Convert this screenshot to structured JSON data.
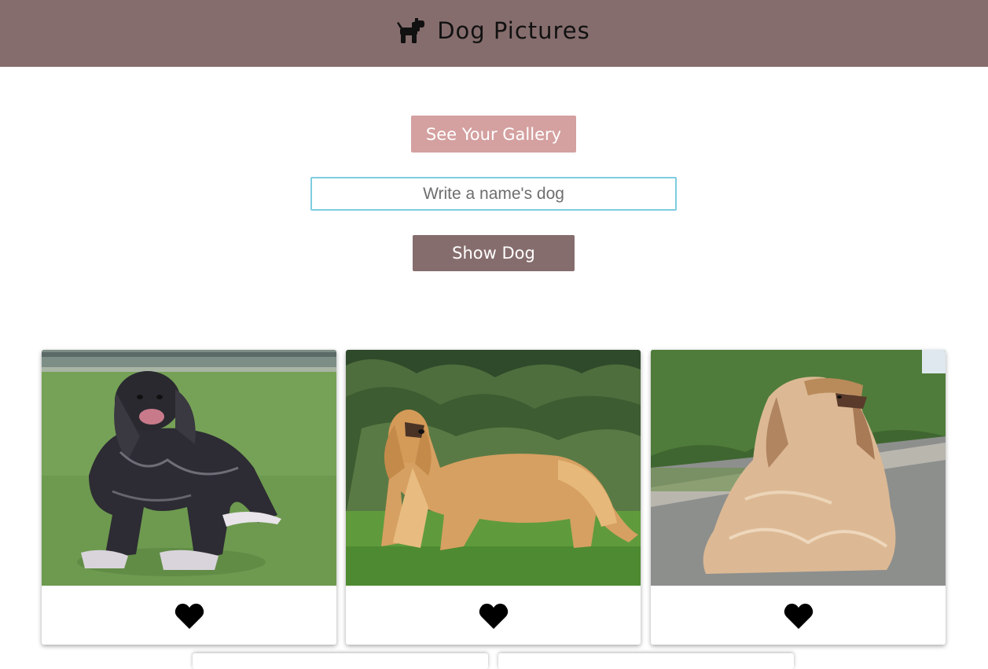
{
  "header": {
    "title": "Dog Pictures",
    "icon": "dog-icon",
    "background": "#866d6d"
  },
  "controls": {
    "gallery_label": "See Your Gallery",
    "gallery_color": "#d4a0a0",
    "name_placeholder": "Write a name's dog",
    "name_value": "",
    "show_label": "Show Dog",
    "show_color": "#866d6d"
  },
  "cards": [
    {
      "photo": "black-afghan-hound-photo",
      "action_icon": "heart-icon"
    },
    {
      "photo": "golden-afghan-hound-photo",
      "action_icon": "heart-icon"
    },
    {
      "photo": "cream-afghan-hound-photo",
      "action_icon": "heart-icon"
    }
  ]
}
